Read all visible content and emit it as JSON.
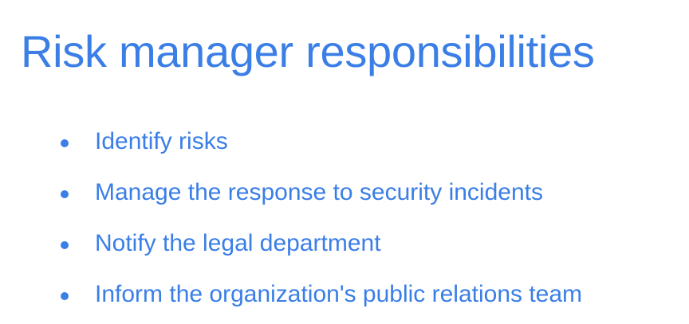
{
  "slide": {
    "title": "Risk manager responsibilities",
    "accent_color": "#3a7ee6",
    "bullets": [
      {
        "text": "Identify risks",
        "icon": "bullet-dot-icon"
      },
      {
        "text": "Manage the response to security incidents",
        "icon": "bullet-dot-icon"
      },
      {
        "text": "Notify the legal department",
        "icon": "bullet-dot-icon"
      },
      {
        "text": "Inform the organization's public relations team",
        "icon": "bullet-dot-icon"
      }
    ]
  }
}
